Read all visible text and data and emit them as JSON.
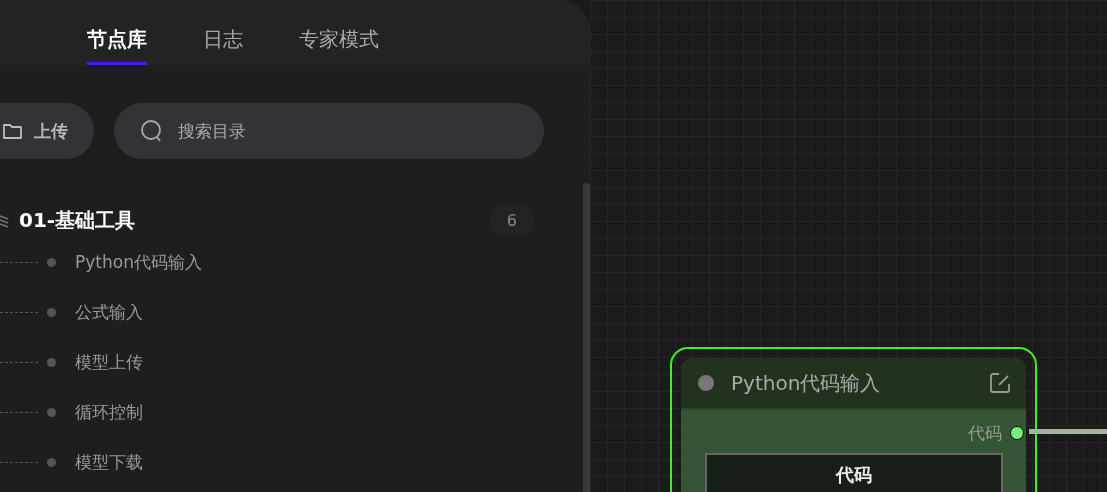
{
  "tabs": [
    {
      "label": "节点库",
      "selected": true
    },
    {
      "label": "日志",
      "selected": false
    },
    {
      "label": "专家模式",
      "selected": false
    }
  ],
  "toolbar": {
    "upload_button": "上传",
    "search": {
      "placeholder": "搜索目录"
    }
  },
  "category": {
    "title": "01-基础工具",
    "count": "6",
    "items": [
      "Python代码输入",
      "公式输入",
      "模型上传",
      "循环控制",
      "模型下载"
    ]
  },
  "node": {
    "title": "Python代码输入",
    "selected": true,
    "outputs": [
      {
        "label": "代码",
        "connected": true
      }
    ],
    "fields": [
      {
        "label": "代码"
      }
    ]
  }
}
